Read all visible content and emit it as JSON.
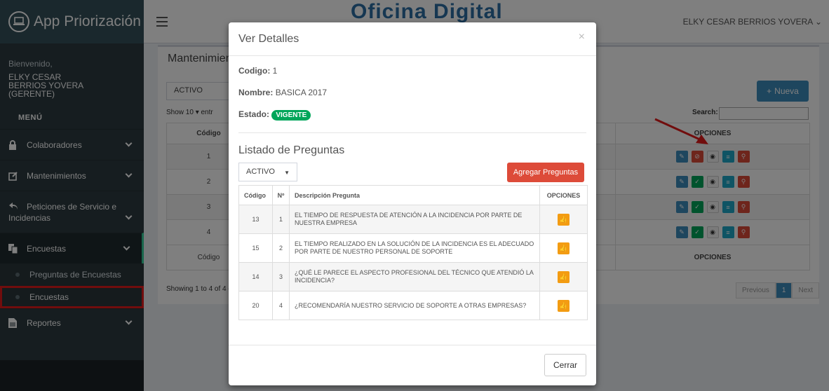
{
  "app": {
    "title": "App Priorización",
    "brand_center": "Oficina Digital",
    "user_menu": "ELKY CESAR BERRIOS YOVERA"
  },
  "sidebar": {
    "welcome": "Bienvenido,",
    "user_name_line1": "ELKY CESAR",
    "user_name_line2": "BERRIOS YOVERA",
    "user_role": "(GERENTE)",
    "menu_label": "MENÚ",
    "items": [
      {
        "label": "Colaboradores",
        "icon": "lock-icon"
      },
      {
        "label": "Mantenimientos",
        "icon": "edit-icon"
      },
      {
        "label": "Peticiones de Servicio e",
        "label2": "Incidencias",
        "icon": "reply-icon"
      },
      {
        "label": "Encuestas",
        "icon": "copy-icon"
      },
      {
        "label": "Reportes",
        "icon": "file-icon"
      }
    ],
    "sub_items": [
      {
        "label": "Preguntas de Encuestas"
      },
      {
        "label": "Encuestas"
      }
    ]
  },
  "background": {
    "box_title": "Mantenimien",
    "select": "ACTIVO",
    "show_label": "Show 10 ▾ entr",
    "new_button": "Nueva",
    "search_label": "Search:",
    "col_codigo": "Código",
    "col_opciones": "OPCIONES",
    "rows": [
      "1",
      "2",
      "3",
      "4"
    ],
    "info": "Showing 1 to 4 of 4 e",
    "pager": [
      "Previous",
      "1",
      "Next"
    ]
  },
  "modal": {
    "title": "Ver Detalles",
    "close_symbol": "×",
    "codigo_label": "Codigo:",
    "codigo_value": "1",
    "nombre_label": "Nombre:",
    "nombre_value": "BASICA 2017",
    "estado_label": "Estado:",
    "estado_value": "VIGENTE",
    "list_title": "Listado de Preguntas",
    "filter_select": "ACTIVO",
    "add_button": "Agregar Preguntas",
    "columns": [
      "Código",
      "Nº",
      "Descripción Pregunta",
      "OPCIONES"
    ],
    "rows": [
      {
        "codigo": "13",
        "n": "1",
        "desc": "EL TIEMPO DE RESPUESTA DE ATENCIÓN A LA INCIDENCIA POR PARTE DE NUESTRA EMPRESA"
      },
      {
        "codigo": "15",
        "n": "2",
        "desc": "EL TIEMPO REALIZADO EN LA SOLUCIÓN DE LA INCIDENCIA ES EL ADECUADO POR PARTE DE NUESTRO PERSONAL DE SOPORTE"
      },
      {
        "codigo": "14",
        "n": "3",
        "desc": "¿QUÉ LE PARECE EL ASPECTO PROFESIONAL DEL TÉCNICO QUE ATENDIÓ LA INCIDENCIA?"
      },
      {
        "codigo": "20",
        "n": "4",
        "desc": "¿RECOMENDARÍA NUESTRO SERVICIO DE SOPORTE A OTRAS EMPRESAS?"
      }
    ],
    "close_button": "Cerrar"
  },
  "colors": {
    "sidebar": "#2c3b41",
    "primary": "#3c8dbc",
    "danger": "#dd4b39",
    "success": "#00a65a",
    "warning": "#f39c12"
  }
}
